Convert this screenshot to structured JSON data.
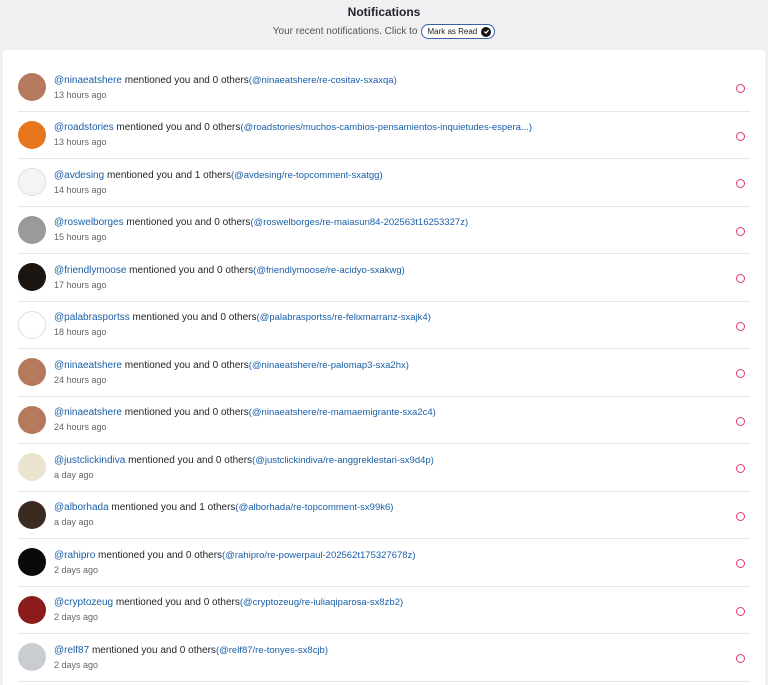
{
  "header": {
    "title": "Notifications",
    "subtitle": "Your recent notifications. Click to",
    "mark_read_label": "Mark as Read"
  },
  "notifications": [
    {
      "user": "@ninaeatshere",
      "text": " mentioned you and 0 others",
      "link": "(@ninaeatshere/re-cositav-sxaxqa)",
      "time": "13 hours ago",
      "avatar_color": "#b57a5e"
    },
    {
      "user": "@roadstories",
      "text": " mentioned you and 0 others",
      "link": "(@roadstories/muchos-cambios-pensamientos-inquietudes-espera...)",
      "time": "13 hours ago",
      "avatar_color": "#e8761d"
    },
    {
      "user": "@avdesing",
      "text": " mentioned you and 1 others",
      "link": "(@avdesing/re-topcomment-sxatgg)",
      "time": "14 hours ago",
      "avatar_color": "#f4f4f4"
    },
    {
      "user": "@roswelborges",
      "text": " mentioned you and 0 others",
      "link": "(@roswelborges/re-maiasun84-202563t16253327z)",
      "time": "15 hours ago",
      "avatar_color": "#9a9a9a"
    },
    {
      "user": "@friendlymoose",
      "text": " mentioned you and 0 others",
      "link": "(@friendlymoose/re-acidyo-sxakwg)",
      "time": "17 hours ago",
      "avatar_color": "#1d1610"
    },
    {
      "user": "@palabrasportss",
      "text": " mentioned you and 0 others",
      "link": "(@palabrasportss/re-felixmarranz-sxajk4)",
      "time": "18 hours ago",
      "avatar_color": "#ffffff"
    },
    {
      "user": "@ninaeatshere",
      "text": " mentioned you and 0 others",
      "link": "(@ninaeatshere/re-palomap3-sxa2hx)",
      "time": "24 hours ago",
      "avatar_color": "#b57a5e"
    },
    {
      "user": "@ninaeatshere",
      "text": " mentioned you and 0 others",
      "link": "(@ninaeatshere/re-mamaemigrante-sxa2c4)",
      "time": "24 hours ago",
      "avatar_color": "#b57a5e"
    },
    {
      "user": "@justclickindiva",
      "text": " mentioned you and 0 others",
      "link": "(@justclickindiva/re-anggreklestari-sx9d4p)",
      "time": "a day ago",
      "avatar_color": "#e9e3cf"
    },
    {
      "user": "@alborhada",
      "text": " mentioned you and 1 others",
      "link": "(@alborhada/re-topcomment-sx99k6)",
      "time": "a day ago",
      "avatar_color": "#3b2a20"
    },
    {
      "user": "@rahipro",
      "text": " mentioned you and 0 others",
      "link": "(@rahipro/re-powerpaul-202562t175327678z)",
      "time": "2 days ago",
      "avatar_color": "#0a0a0a"
    },
    {
      "user": "@cryptozeug",
      "text": " mentioned you and 0 others",
      "link": "(@cryptozeug/re-iuliaqiparosa-sx8zb2)",
      "time": "2 days ago",
      "avatar_color": "#8c1c1c"
    },
    {
      "user": "@relf87",
      "text": " mentioned you and 0 others",
      "link": "(@relf87/re-tonyes-sx8cjb)",
      "time": "2 days ago",
      "avatar_color": "#c9cdd2"
    }
  ]
}
